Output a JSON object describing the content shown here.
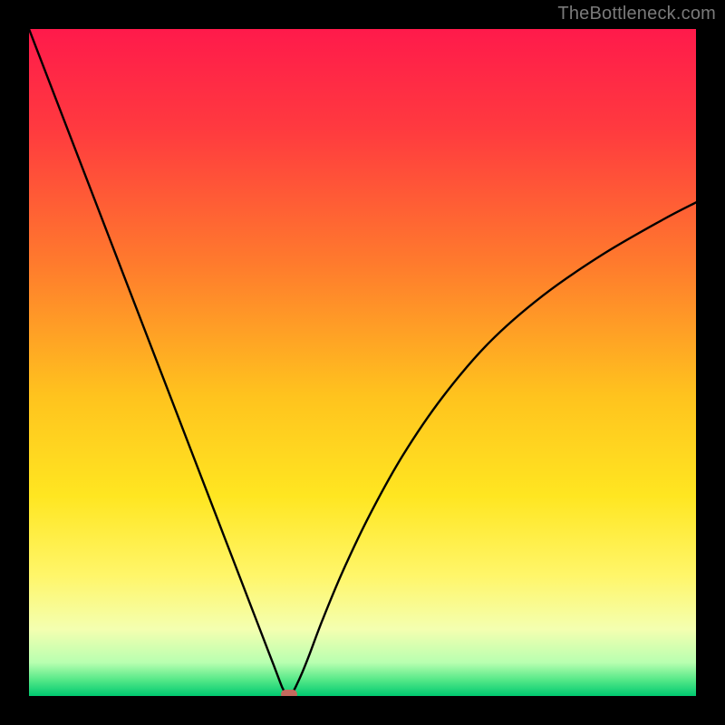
{
  "watermark": {
    "text": "TheBottleneck.com"
  },
  "chart_data": {
    "type": "line",
    "title": "",
    "xlabel": "",
    "ylabel": "",
    "xlim": [
      0,
      100
    ],
    "ylim": [
      0,
      100
    ],
    "grid": false,
    "legend": false,
    "background_gradient": {
      "stops": [
        {
          "offset": 0.0,
          "color": "#ff1a4b"
        },
        {
          "offset": 0.15,
          "color": "#ff3a3f"
        },
        {
          "offset": 0.35,
          "color": "#ff7a2d"
        },
        {
          "offset": 0.55,
          "color": "#ffc31e"
        },
        {
          "offset": 0.7,
          "color": "#ffe621"
        },
        {
          "offset": 0.82,
          "color": "#fff66a"
        },
        {
          "offset": 0.9,
          "color": "#f4ffb0"
        },
        {
          "offset": 0.95,
          "color": "#b8ffb0"
        },
        {
          "offset": 0.975,
          "color": "#58e989"
        },
        {
          "offset": 1.0,
          "color": "#00c970"
        }
      ]
    },
    "series": [
      {
        "name": "bottleneck-curve",
        "color": "#000000",
        "x": [
          0,
          4,
          8,
          12,
          16,
          20,
          24,
          28,
          32,
          34,
          36,
          37,
          38,
          38.5,
          39,
          39.5,
          40,
          41,
          42,
          44,
          47,
          51,
          56,
          62,
          69,
          77,
          86,
          95,
          100
        ],
        "y": [
          100,
          89.6,
          79.2,
          68.8,
          58.4,
          48,
          37.6,
          27.2,
          16.8,
          11.6,
          6.4,
          3.8,
          1.2,
          0.5,
          0,
          0.5,
          1.4,
          3.6,
          6.1,
          11.4,
          18.6,
          27.0,
          36.0,
          44.8,
          53.0,
          60.0,
          66.2,
          71.4,
          74.0
        ]
      }
    ],
    "marker": {
      "x": 39,
      "y": 0,
      "color": "#c46a5e"
    }
  }
}
